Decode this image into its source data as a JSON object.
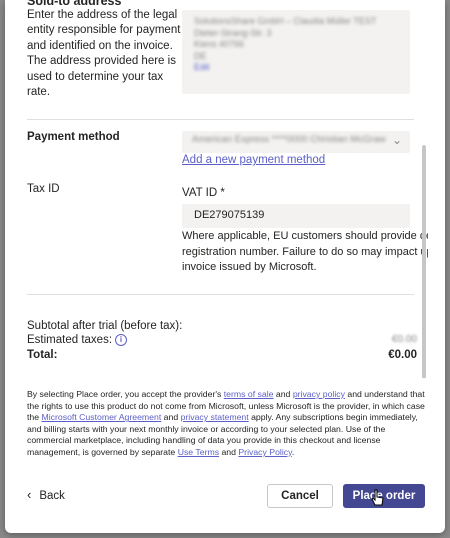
{
  "sold_to": {
    "title": "Sold-to address",
    "description": "Enter the address of the legal entity responsible for payment and identified on the invoice. The address provided here is used to determine your tax rate.",
    "address_lines": [
      "SolutionsShare GmbH – Claudia Müller TEST",
      "Dieter-Strang-Str. 3",
      "Kiens 40766",
      "DE"
    ],
    "edit_label": "Edit"
  },
  "payment": {
    "label": "Payment method",
    "selected": "American Express ****0000 Christian McGraw",
    "add_link": "Add a new payment method"
  },
  "tax": {
    "label": "Tax ID",
    "vat_label": "VAT ID *",
    "vat_value": "DE279075139",
    "help_line1": "Where applicable, EU customers should provide deta",
    "help_line2": "registration number. Failure to do so may impact upo",
    "help_line3": "invoice issued by Microsoft."
  },
  "totals": {
    "subtotal_label": "Subtotal after trial (before tax):",
    "estimated_taxes_label": "Estimated taxes:",
    "estimated_taxes_value": "€0.00",
    "total_label": "Total:",
    "total_value": "€0.00"
  },
  "legal": {
    "t1": "By selecting Place order, you accept the provider's ",
    "terms_of_sale": "terms of sale",
    "t2": " and ",
    "privacy_policy": "privacy policy",
    "t3": " and understand that the rights to use this product do not come from Microsoft, unless Microsoft is the provider, in which case the ",
    "mca": "Microsoft Customer Agreement",
    "t4": " and ",
    "privacy_statement": "privacy statement",
    "t5": " apply. Any subscriptions begin immediately, and billing starts with your next monthly invoice or according to your selected plan. Use of the commercial marketplace, including handling of data you provide in this checkout and license management, is governed by separate ",
    "use_terms": "Use Terms",
    "t6": " and ",
    "privacy_policy2": "Privacy Policy",
    "t7": "."
  },
  "footer": {
    "back_label": "Back",
    "cancel_label": "Cancel",
    "place_order_label": "Place order"
  },
  "colors": {
    "accent": "#444791",
    "link": "#5b5fc7"
  }
}
